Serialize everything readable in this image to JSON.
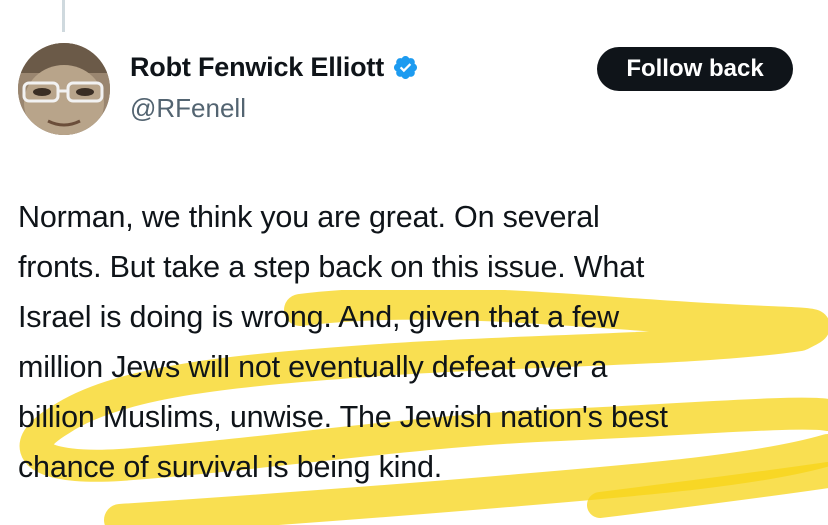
{
  "author": {
    "display_name": "Robt Fenwick Elliott",
    "handle": "@RFenell",
    "verified": true,
    "verified_icon": "verified-badge-icon",
    "verified_color": "#1d9bf0"
  },
  "actions": {
    "follow_label": "Follow back"
  },
  "tweet": {
    "text": "Norman, we think you are great. On several\nfronts. But take a step back on this issue. What\nIsrael is doing is wrong. And, given that a few\nmillion Jews will not eventually defeat over a\nbillion Muslims, unwise. The Jewish nation's best\nchance of survival is being kind."
  },
  "colors": {
    "text": "#0f1419",
    "secondary_text": "#536471",
    "button_bg": "#0f1419",
    "highlight": "#f7d417"
  }
}
